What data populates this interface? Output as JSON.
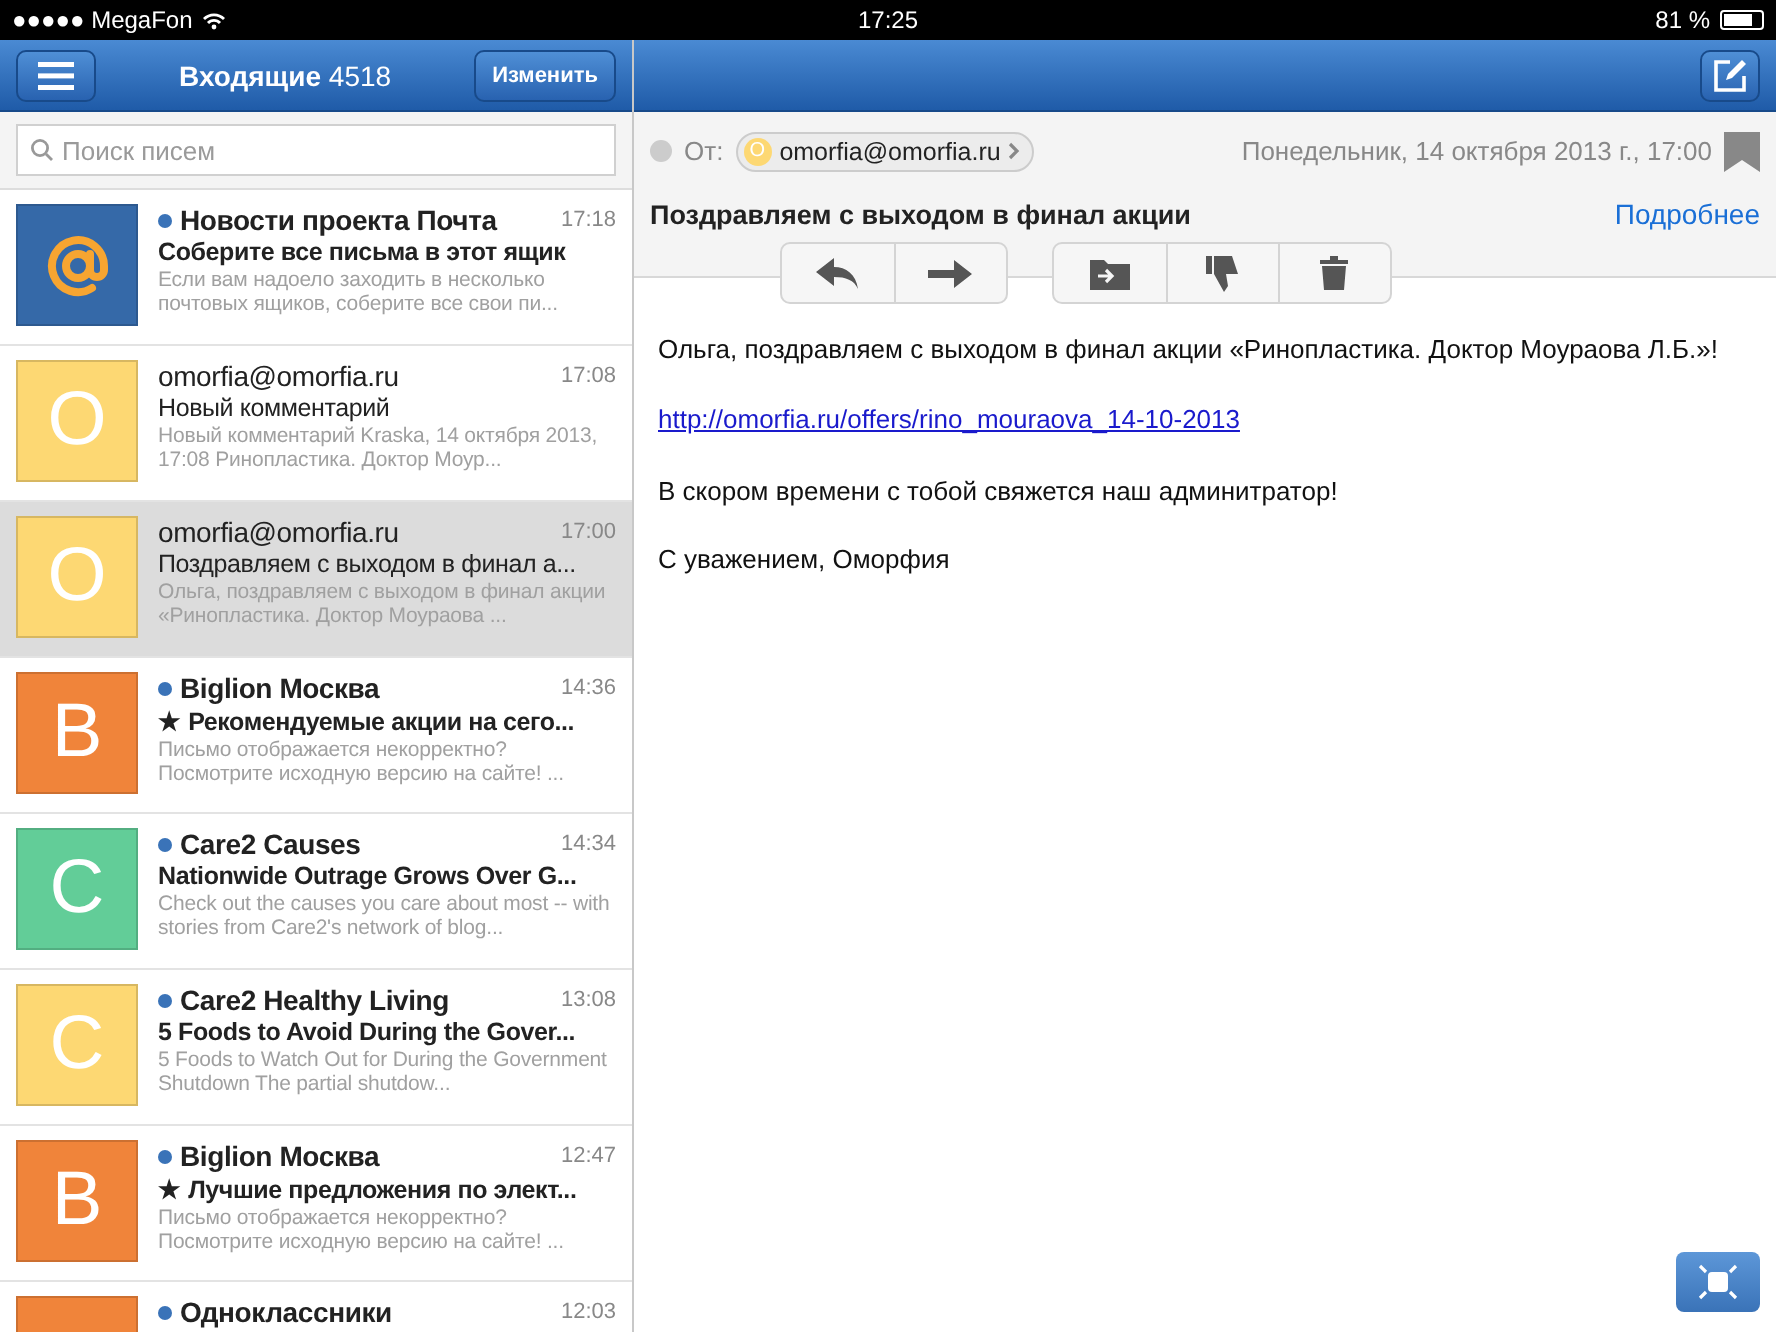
{
  "status_bar": {
    "carrier": "●●●●● MegaFon",
    "time": "17:25",
    "battery": "81 %"
  },
  "nav": {
    "title": "Входящие",
    "count": "4518",
    "edit_button": "Изменить"
  },
  "search": {
    "placeholder": "Поиск писем"
  },
  "messages": [
    {
      "sender": "Новости проекта Почта",
      "time": "17:18",
      "subject": "Соберите все письма в этот ящик",
      "preview": "Если вам надоело заходить в несколько почтовых ящиков, соберите все свои пи...",
      "unread": true,
      "selected": false,
      "avatar": {
        "kind": "at",
        "color": "#3569a8"
      }
    },
    {
      "sender": "omorfia@omorfia.ru",
      "time": "17:08",
      "subject": "Новый комментарий",
      "preview": "Новый комментарий Kraska, 14 октября 2013, 17:08 Ринопластика. Доктор Моур...",
      "unread": false,
      "selected": false,
      "avatar": {
        "kind": "letter",
        "letter": "O",
        "color": "#fdd873"
      }
    },
    {
      "sender": "omorfia@omorfia.ru",
      "time": "17:00",
      "subject": "Поздравляем с выходом в финал а...",
      "preview": "Ольга, поздравляем с выходом в финал акции «Ринопластика. Доктор Моураова ...",
      "unread": false,
      "selected": true,
      "avatar": {
        "kind": "letter",
        "letter": "O",
        "color": "#fdd873"
      }
    },
    {
      "sender": "Biglion Москва",
      "time": "14:36",
      "subject": "★ Рекомендуемые акции на сего...",
      "preview": "Письмо отображается некорректно? Посмотрите исходную версию на сайте! ...",
      "unread": true,
      "selected": false,
      "avatar": {
        "kind": "letter",
        "letter": "B",
        "color": "#f0843a"
      }
    },
    {
      "sender": "Care2 Causes",
      "time": "14:34",
      "subject": "Nationwide Outrage Grows Over G...",
      "preview": "Check out the causes you care about most -- with stories from Care2's network of blog...",
      "unread": true,
      "selected": false,
      "avatar": {
        "kind": "letter",
        "letter": "C",
        "color": "#62cd98"
      }
    },
    {
      "sender": "Care2 Healthy Living",
      "time": "13:08",
      "subject": "5 Foods to Avoid During the Gover...",
      "preview": "5 Foods to Watch Out for During the Government Shutdown The partial shutdow...",
      "unread": true,
      "selected": false,
      "avatar": {
        "kind": "letter",
        "letter": "C",
        "color": "#fdd873"
      }
    },
    {
      "sender": "Biglion Москва",
      "time": "12:47",
      "subject": "★ Лучшие предложения по элект...",
      "preview": "Письмо отображается некорректно? Посмотрите исходную версию на сайте! ...",
      "unread": true,
      "selected": false,
      "avatar": {
        "kind": "letter",
        "letter": "B",
        "color": "#f0843a"
      }
    },
    {
      "sender": "Одноклассники",
      "time": "12:03",
      "unread": true,
      "selected": false,
      "avatar": {
        "kind": "blank",
        "color": "#f0843a"
      }
    }
  ],
  "message": {
    "from_label": "От:",
    "from_avatar_letter": "O",
    "from": "omorfia@omorfia.ru",
    "date": "Понедельник, 14 октября 2013 г., 17:00",
    "subject": "Поздравляем с выходом в финал акции",
    "details_link": "Подробнее",
    "body": [
      {
        "kind": "text",
        "text": "Ольга, поздравляем с выходом в финал акции «Ринопластика. Доктор Моураова Л.Б.»!"
      },
      {
        "kind": "link",
        "text": "http://omorfia.ru/offers/rino_mouraova_14-10-2013"
      },
      {
        "kind": "text",
        "text": "В скором времени с тобой свяжется наш админитратор!"
      },
      {
        "kind": "text",
        "text": "С уважением, Оморфия"
      }
    ]
  }
}
